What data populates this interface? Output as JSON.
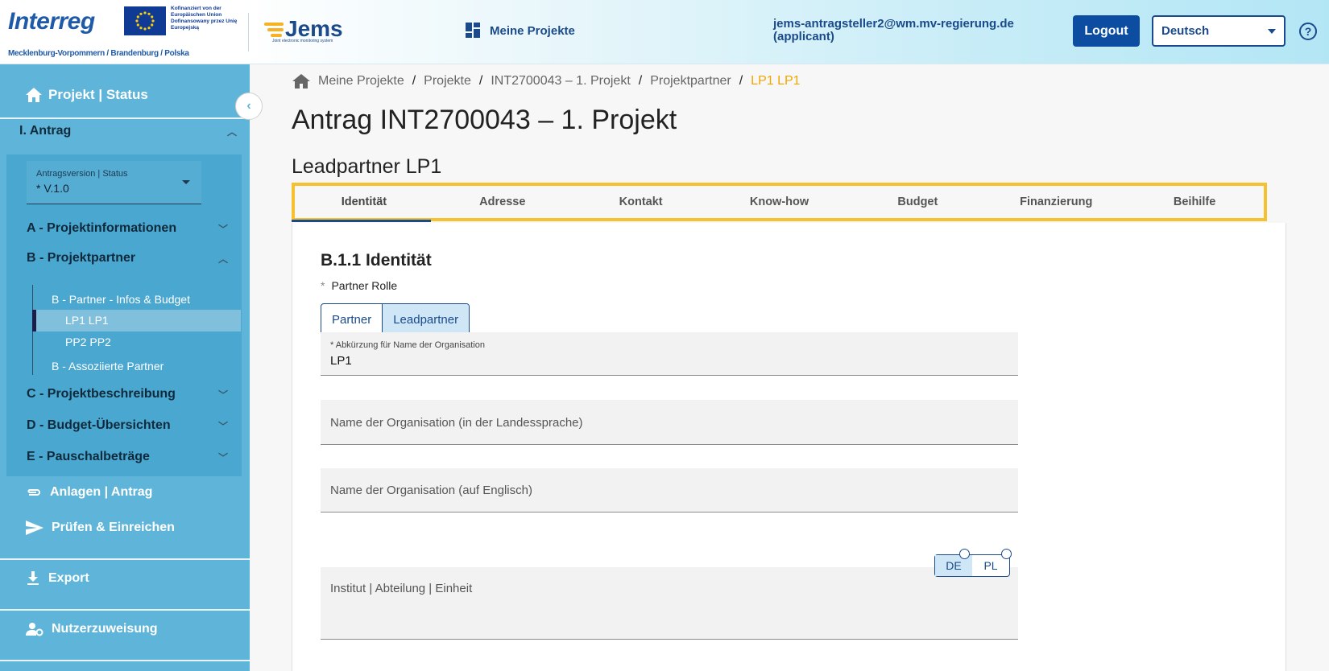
{
  "header": {
    "brand": {
      "interreg": "Interreg",
      "eu_text": "Kofinanziert von der Europäischen Union Dofinansowany przez Unię Europejską",
      "region": "Mecklenburg-Vorpommern / Brandenburg / Polska",
      "jems": "Jems",
      "jems_sub": "Joint electronic monitoring system"
    },
    "nav_projects": "Meine Projekte",
    "user_email": "jems-antragsteller2@wm.mv-regierung.de",
    "user_role": "(applicant)",
    "logout": "Logout",
    "language": "Deutsch",
    "help": "?"
  },
  "sidebar": {
    "project_status": "Projekt | Status",
    "antrag": "I. Antrag",
    "version_label": "Antragsversion | Status",
    "version_value": "* V.1.0",
    "groups": {
      "a": "A - Projektinformationen",
      "b": "B - Projektpartner",
      "c": "C - Projektbeschreibung",
      "d": "D - Budget-Übersichten",
      "e": "E - Pauschalbeträge"
    },
    "b_items": {
      "infos": "B - Partner - Infos & Budget",
      "lp1": "LP1 LP1",
      "pp2": "PP2 PP2",
      "assoc": "B - Assoziierte Partner"
    },
    "anlagen": "Anlagen | Antrag",
    "pruefen": "Prüfen & Einreichen",
    "export": "Export",
    "nutzer": "Nutzerzuweisung"
  },
  "breadcrumb": [
    "Meine Projekte",
    "Projekte",
    "INT2700043 – 1. Projekt",
    "Projektpartner",
    "LP1 LP1"
  ],
  "page_title": "Antrag INT2700043 – 1. Projekt",
  "section_title": "Leadpartner LP1",
  "tabs": [
    "Identität",
    "Adresse",
    "Kontakt",
    "Know-how",
    "Budget",
    "Finanzierung",
    "Beihilfe"
  ],
  "form": {
    "title": "B.1.1 Identität",
    "role_label": "Partner Rolle",
    "role_options": [
      "Partner",
      "Leadpartner"
    ],
    "abbr_label": "* Abkürzung für Name der Organisation",
    "abbr_value": "LP1",
    "name_local_placeholder": "Name der Organisation (in der Landessprache)",
    "name_en_placeholder": "Name der Organisation (auf Englisch)",
    "institute_placeholder": "Institut | Abteilung | Einheit",
    "languages": [
      "DE",
      "PL"
    ]
  }
}
